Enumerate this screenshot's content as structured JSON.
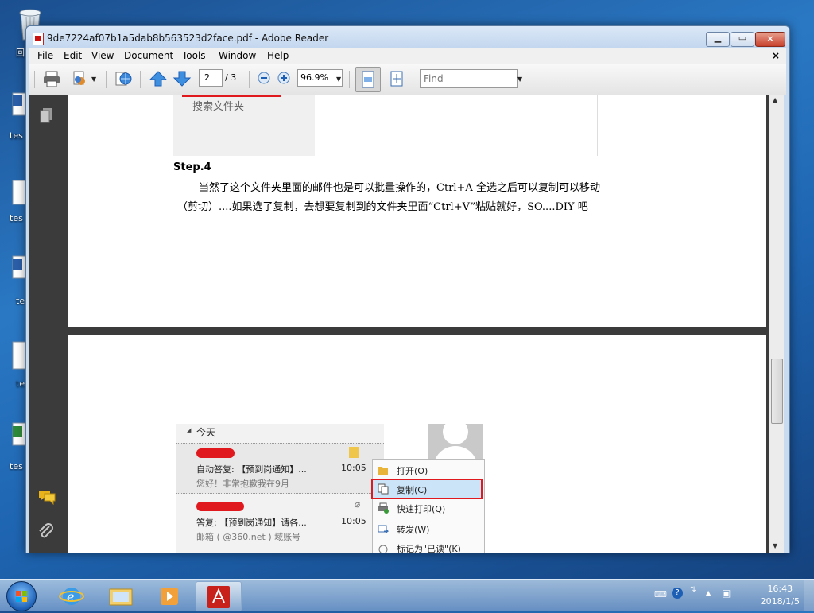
{
  "desktop": {
    "icons": [
      {
        "label": "回"
      },
      {
        "label": "tes"
      },
      {
        "label": "tes"
      },
      {
        "label": "te"
      },
      {
        "label": "te"
      },
      {
        "label": "tes"
      }
    ]
  },
  "window": {
    "title": "9de7224af07b1a5dab8b563523d2face.pdf - Adobe Reader",
    "close_symbol": "×"
  },
  "menu": {
    "items": [
      "File",
      "Edit",
      "View",
      "Document",
      "Tools",
      "Window",
      "Help"
    ],
    "doc_close": "×"
  },
  "toolbar": {
    "page_current": "2",
    "page_total": "/ 3",
    "zoom": "96.9%",
    "find_placeholder": "Find"
  },
  "page1": {
    "upper_text": "搜索文件夹",
    "step_heading": "Step.4",
    "para_line1": "当然了这个文件夹里面的邮件也是可以批量操作的，Ctrl+A 全选之后可以复制可以移动",
    "para_line2": "（剪切）....如果选了复制，去想要复制到的文件夹里面“Ctrl+V”粘贴就好，SO....DIY 吧"
  },
  "page2": {
    "group_label": "今天",
    "mail1": {
      "subject": "自动答复: 【预到岗通知】...",
      "time": "10:05",
      "preview": "您好！非常抱歉我在9月"
    },
    "mail2": {
      "subject": "答复: 【预到岗通知】请各...",
      "time": "10:05",
      "preview": "邮箱 ( @360.net ) 域账号"
    },
    "context_menu": [
      {
        "label": "打开(O)"
      },
      {
        "label": "复制(C)"
      },
      {
        "label": "快速打印(Q)"
      },
      {
        "label": "转发(W)"
      },
      {
        "label": "标记为\"已读\"(K)"
      }
    ]
  },
  "taskbar": {
    "time": "16:43",
    "date": "2018/1/5"
  },
  "colors": {
    "highlight_red": "#e0191f",
    "accent_blue": "#1d5fb4",
    "menu_hover": "#cce4f7"
  }
}
